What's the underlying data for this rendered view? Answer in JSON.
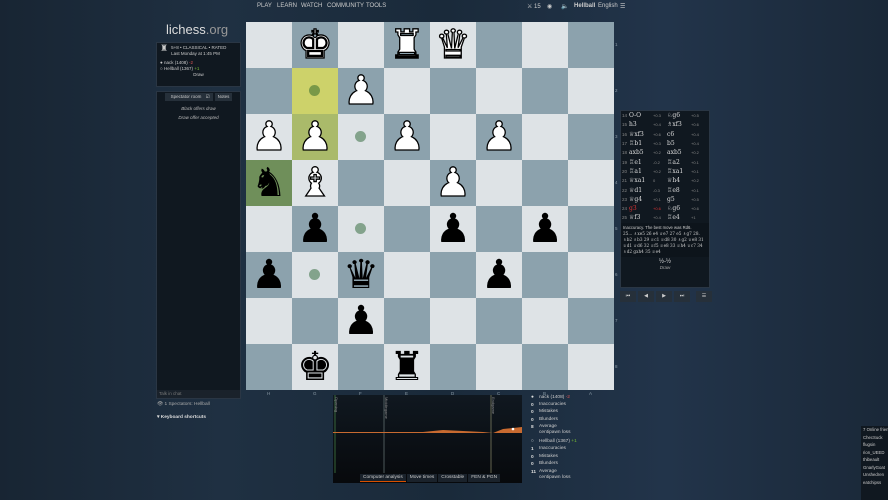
{
  "nav": {
    "items": [
      "PLAY",
      "LEARN",
      "WATCH",
      "COMMUNITY",
      "TOOLS"
    ],
    "count": "15",
    "user": "Hellball",
    "language": "English"
  },
  "logo": {
    "main": "lichess",
    "tld": ".org"
  },
  "game": {
    "type": "5+8 • CLASSICAL • RATED",
    "when": "Last Monday at 1:45 PM",
    "white": "nack (1408)",
    "white_diff": "-2",
    "black": "Hellball (1367)",
    "black_diff": "+1",
    "result": "Draw"
  },
  "chat": {
    "tabs": [
      "Spectator room",
      "Notes"
    ],
    "messages": [
      "Black offers draw",
      "Draw offer accepted"
    ],
    "placeholder": "Talk in chat",
    "spectators": "1 Spectators: Hellball",
    "shortcuts": "Keyboard shortcuts"
  },
  "board": {
    "rows": [
      ".K.RQ...",
      "..P.....",
      "PP.P.P..",
      "nB..P...",
      ".p..p.p.",
      "p.q..p..",
      "..p.....",
      ".k.r...."
    ],
    "files": [
      "H",
      "G",
      "F",
      "E",
      "D",
      "C",
      "B",
      "A"
    ],
    "ranks": [
      "1",
      "2",
      "3",
      "4",
      "5",
      "6",
      "7",
      "8"
    ],
    "highlight_light": [
      [
        1,
        1
      ],
      [
        2,
        1
      ]
    ],
    "highlight_dark": [
      [
        3,
        0
      ]
    ],
    "dots": [
      [
        1,
        1
      ],
      [
        2,
        2
      ],
      [
        4,
        2
      ],
      [
        5,
        1
      ]
    ]
  },
  "moves": [
    [
      "14",
      "O-O",
      "+0.3",
      "♘g6",
      "+0.5"
    ],
    [
      "15",
      "h3",
      "+0.4",
      "♗xf3",
      "+0.6"
    ],
    [
      "16",
      "♕xf3",
      "+0.6",
      "c6",
      "+0.4"
    ],
    [
      "17",
      "♖b1",
      "+0.3",
      "b5",
      "+0.4"
    ],
    [
      "18",
      "axb5",
      "+0.2",
      "axb5",
      "+0.2"
    ],
    [
      "19",
      "♖e1",
      "-0.2",
      "♖a2",
      "+0.1"
    ],
    [
      "20",
      "♖a1",
      "+0.2",
      "♖xa1",
      "+0.1"
    ],
    [
      "21",
      "♕xa1",
      "0",
      "♕h4",
      "+0.2"
    ],
    [
      "22",
      "♕d1",
      "-0.3",
      "♖e8",
      "+0.1"
    ],
    [
      "23",
      "♕g4",
      "+0.1",
      "g5",
      "+0.5"
    ],
    [
      "24",
      "g3",
      "+0.6",
      "♘g6",
      "+0.6"
    ],
    [
      "25",
      "♕f3",
      "+0.4",
      "♖e4",
      "+1"
    ]
  ],
  "comment": {
    "text": "Inaccuracy. The best move was Rd6.",
    "line": "25... ♗xe5 26 e4 ♕e7 27 e5 ♗g7 28. ♗b2 ♗b3 29 ♕c1 ♕d8 30 ♗g2 ♕e8 31 ♕d1 ♕d6 32 ♕f5 ♕e8 33 ♕h4 ♕c7 34 ♗d2 gxh4 35 ♕e4"
  },
  "result": {
    "score": "½-½",
    "status": "Draw"
  },
  "controls": [
    "⏮",
    "◀",
    "▶",
    "⏭",
    "☰"
  ],
  "chart": {
    "phases": [
      "Opening",
      "Middlegame",
      "Endgame"
    ],
    "tabs": [
      "Computer analysis",
      "Move times",
      "Crosstable",
      "FEN & PGN"
    ]
  },
  "summary": {
    "white": {
      "name": "nack (1408)",
      "diff": "-2",
      "stats": [
        [
          "0",
          "Inaccuracies"
        ],
        [
          "0",
          "Mistakes"
        ],
        [
          "0",
          "Blunders"
        ],
        [
          "8",
          "Average centipawn loss"
        ]
      ]
    },
    "black": {
      "name": "Hellball (1367)",
      "diff": "+1",
      "stats": [
        [
          "1",
          "Inaccuracies"
        ],
        [
          "0",
          "Mistakes"
        ],
        [
          "0",
          "Blunders"
        ],
        [
          "11",
          "Average centipawn loss"
        ]
      ]
    }
  },
  "friends": {
    "title": "7 Online friends",
    "list": [
      "ChecSuck",
      "flugsin",
      "rion_UEED",
      "thibeault",
      "GnarlyGoat",
      "Unshedren",
      "eatchipss"
    ]
  },
  "colors": {
    "light": "#dee3e6",
    "dark": "#8ca2ad",
    "hl_light": "#cdd26a",
    "hl_dark": "#6f8f5a",
    "accent": "#d85000"
  }
}
